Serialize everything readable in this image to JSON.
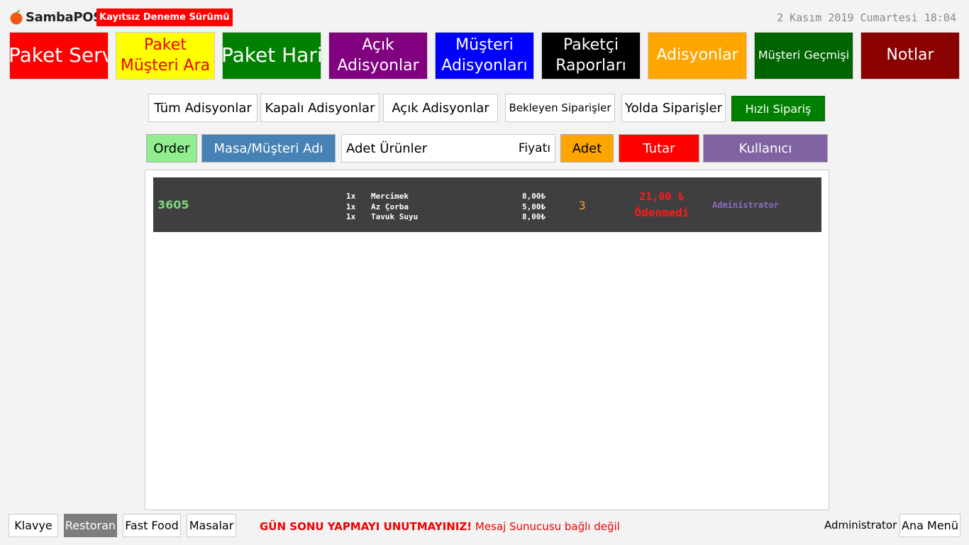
{
  "header": {
    "brand": "SambaPOS",
    "trial_badge": "Kayıtsız Deneme Sürümü",
    "datetime": "2 Kasım 2019 Cumartesi 18:04"
  },
  "nav_buttons": [
    {
      "label": "Paket Servis",
      "bg": "#ff0000",
      "fg": "#ffffff"
    },
    {
      "label": "Paket Müşteri Ara",
      "bg": "#ffff00",
      "fg": "#ff0000"
    },
    {
      "label": "Paket Harita",
      "bg": "#008000",
      "fg": "#ffffff"
    },
    {
      "label": "Açık Adisyonlar",
      "bg": "#800080",
      "fg": "#ffffff"
    },
    {
      "label": "Müşteri Adisyonları",
      "bg": "#0000ff",
      "fg": "#ffffff"
    },
    {
      "label": "Paketçi Raporları",
      "bg": "#000000",
      "fg": "#ffffff"
    },
    {
      "label": "Adisyonlar",
      "bg": "#ffa500",
      "fg": "#ffffff"
    },
    {
      "label": "Müşteri Geçmişi",
      "bg": "#006400",
      "fg": "#ffffff"
    },
    {
      "label": "Notlar",
      "bg": "#8b0000",
      "fg": "#ffffff"
    }
  ],
  "filters": [
    {
      "label": "Tüm Adisyonlar"
    },
    {
      "label": "Kapalı Adisyonlar"
    },
    {
      "label": "Açık Adisyonlar"
    },
    {
      "label": "Bekleyen Siparişler"
    },
    {
      "label": "Yolda Siparişler"
    },
    {
      "label": "Hızlı Sipariş"
    }
  ],
  "columns": {
    "order": "Order",
    "customer": "Masa/Müşteri Adı",
    "items": "Adet Ürünler",
    "price": "Fiyatı",
    "qty": "Adet",
    "total": "Tutar",
    "user": "Kullanıcı"
  },
  "column_colors": {
    "order": "#90ee90",
    "customer": "#4682b4",
    "qty": "#ffa500",
    "total": "#ff0000",
    "user": "#8064a2"
  },
  "orders": [
    {
      "number": "3605",
      "items": [
        {
          "qty": "1x",
          "name": "Mercimek",
          "price": "8,00₺"
        },
        {
          "qty": "1x",
          "name": "Az Çorba",
          "price": "5,00₺"
        },
        {
          "qty": "1x",
          "name": "Tavuk Suyu",
          "price": "8,00₺"
        }
      ],
      "count": "3",
      "total": "21,00 ₺",
      "status": "Ödenmedi",
      "user": "Administrator"
    }
  ],
  "footer": {
    "buttons": [
      {
        "label": "Klavye"
      },
      {
        "label": "Restoran"
      },
      {
        "label": "Fast Food"
      },
      {
        "label": "Masalar"
      }
    ],
    "warning_bold": "GÜN SONU YAPMAYI UNUTMAYINIZ!",
    "warning_text": "Mesaj Sunucusu bağlı değil",
    "user": "Administrator",
    "main_menu": "Ana Menü"
  }
}
